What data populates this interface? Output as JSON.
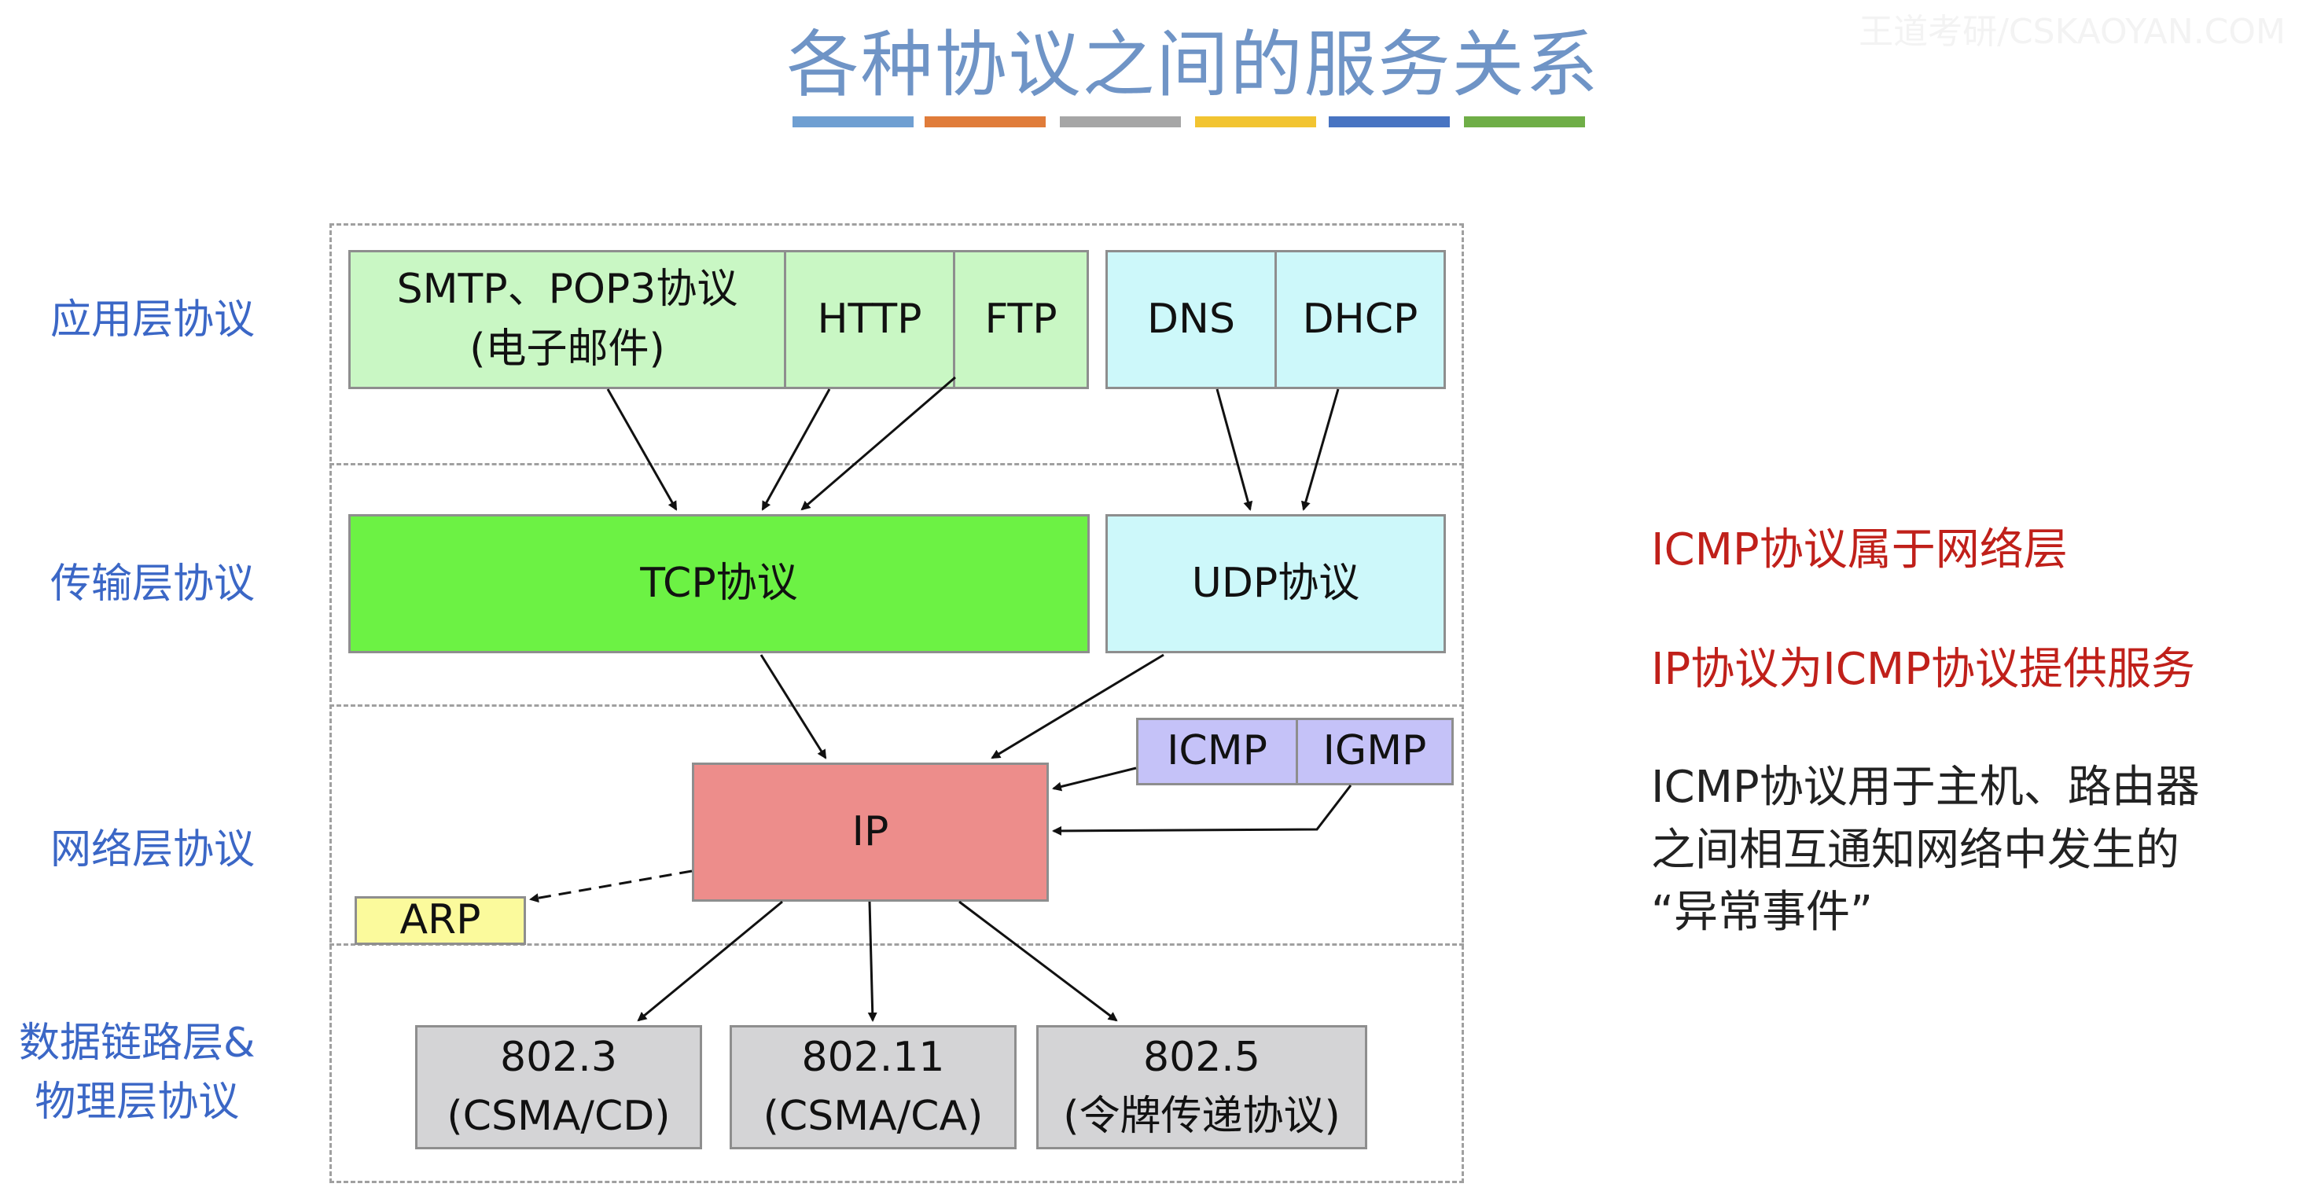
{
  "title": "各种协议之间的服务关系",
  "watermark": "王道考研/CSKAOYAN.COM",
  "stripe_colors": [
    "#6f9fd2",
    "#e07c3a",
    "#a6a6a6",
    "#f2c431",
    "#4874c2",
    "#6fae47"
  ],
  "layers": {
    "application": "应用层协议",
    "transport": "传输层协议",
    "network": "网络层协议",
    "datalink_line1": "数据链路层&",
    "datalink_line2": "物理层协议"
  },
  "boxes": {
    "smtp_line1": "SMTP、POP3协议",
    "smtp_line2": "(电子邮件)",
    "http": "HTTP",
    "ftp": "FTP",
    "dns": "DNS",
    "dhcp": "DHCP",
    "tcp": "TCP协议",
    "udp": "UDP协议",
    "icmp": "ICMP",
    "igmp": "IGMP",
    "ip": "IP",
    "arp": "ARP",
    "e8023_line1": "802.3",
    "e8023_line2": "(CSMA/CD)",
    "e80211_line1": "802.11",
    "e80211_line2": "(CSMA/CA)",
    "e8025_line1": "802.5",
    "e8025_line2": "(令牌传递协议)"
  },
  "notes": {
    "n1": "ICMP协议属于网络层",
    "n2": "IP协议为ICMP协议提供服务",
    "n3_line1": "ICMP协议用于主机、路由器",
    "n3_line2": "之间相互通知网络中发生的",
    "n3_line3": "“异常事件”"
  }
}
